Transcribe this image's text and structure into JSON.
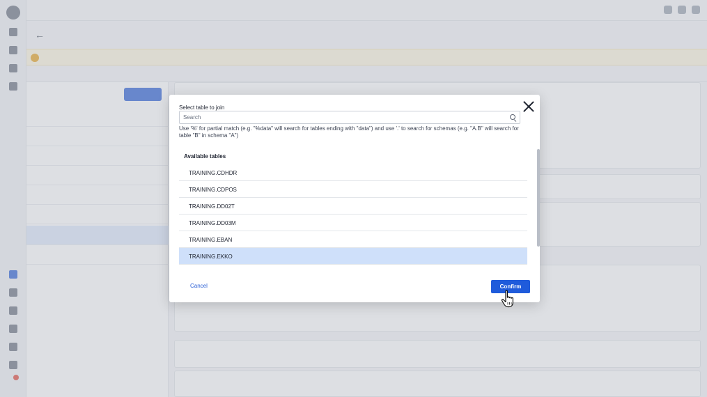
{
  "dialog": {
    "label": "Select table to join",
    "search_placeholder": "Search",
    "hint": "Use '%' for partial match (e.g. \"%data\" will search for tables ending with \"data\") and use '.' to search for schemas (e.g. \"A.B\" will search for table \"B\" in schema \"A\")",
    "section_title": "Available tables",
    "tables": [
      {
        "name": "TRAINING.CDHDR",
        "selected": false
      },
      {
        "name": "TRAINING.CDPOS",
        "selected": false
      },
      {
        "name": "TRAINING.DD02T",
        "selected": false
      },
      {
        "name": "TRAINING.DD03M",
        "selected": false
      },
      {
        "name": "TRAINING.EBAN",
        "selected": false
      },
      {
        "name": "TRAINING.EKKO",
        "selected": true
      }
    ],
    "cancel_label": "Cancel",
    "confirm_label": "Confirm"
  },
  "colors": {
    "accent": "#1f5bdb",
    "selected_row": "#cfe0fa",
    "overlay": "#b4b8c0"
  },
  "icons": {
    "close": "close-icon",
    "search": "search-icon",
    "cursor": "hand-pointer-icon"
  }
}
